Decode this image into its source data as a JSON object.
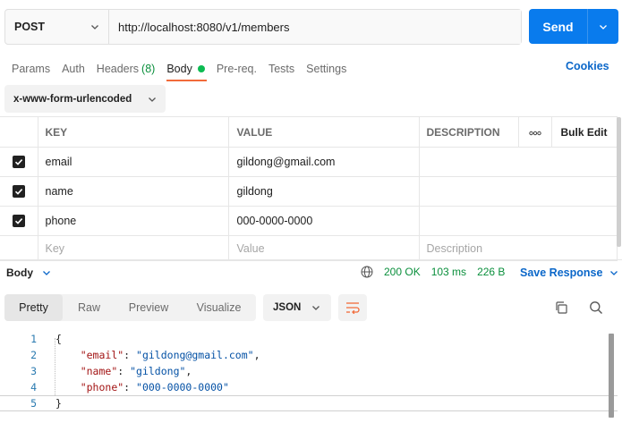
{
  "request": {
    "method": "POST",
    "url": "http://localhost:8080/v1/members",
    "send_label": "Send"
  },
  "tabs": [
    {
      "label": "Params"
    },
    {
      "label": "Auth"
    },
    {
      "label": "Headers",
      "count": "(8)"
    },
    {
      "label": "Body",
      "active": true
    },
    {
      "label": "Pre-req."
    },
    {
      "label": "Tests"
    },
    {
      "label": "Settings"
    }
  ],
  "cookies_label": "Cookies",
  "body_type": "x-www-form-urlencoded",
  "table": {
    "headers": {
      "key": "KEY",
      "value": "VALUE",
      "description": "DESCRIPTION",
      "more": "ooo",
      "bulk_edit": "Bulk Edit"
    },
    "rows": [
      {
        "checked": true,
        "key": "email",
        "value": "gildong@gmail.com",
        "description": ""
      },
      {
        "checked": true,
        "key": "name",
        "value": "gildong",
        "description": ""
      },
      {
        "checked": true,
        "key": "phone",
        "value": "000-0000-0000",
        "description": ""
      }
    ],
    "placeholders": {
      "key": "Key",
      "value": "Value",
      "description": "Description"
    }
  },
  "response": {
    "body_label": "Body",
    "status": "200 OK",
    "time": "103 ms",
    "size": "226 B",
    "save_label": "Save Response",
    "view_tabs": [
      "Pretty",
      "Raw",
      "Preview",
      "Visualize"
    ],
    "active_view": "Pretty",
    "format": "JSON",
    "code_lines": [
      {
        "n": "1",
        "text": "{"
      },
      {
        "n": "2",
        "key": "\"email\"",
        "val": "\"gildong@gmail.com\"",
        "trail": ","
      },
      {
        "n": "3",
        "key": "\"name\"",
        "val": "\"gildong\"",
        "trail": ","
      },
      {
        "n": "4",
        "key": "\"phone\"",
        "val": "\"000-0000-0000\"",
        "trail": ""
      },
      {
        "n": "5",
        "text": "}"
      }
    ]
  },
  "colors": {
    "accent_blue": "#097bed",
    "status_green": "#0a8f3c",
    "active_tab_underline": "#f26b3a",
    "body_dot": "#0cbb52",
    "wrap_icon": "#f26b3a"
  },
  "icons": [
    "chevron-down-icon",
    "globe-icon",
    "wrap-lines-icon",
    "copy-icon",
    "search-icon",
    "check-icon"
  ]
}
